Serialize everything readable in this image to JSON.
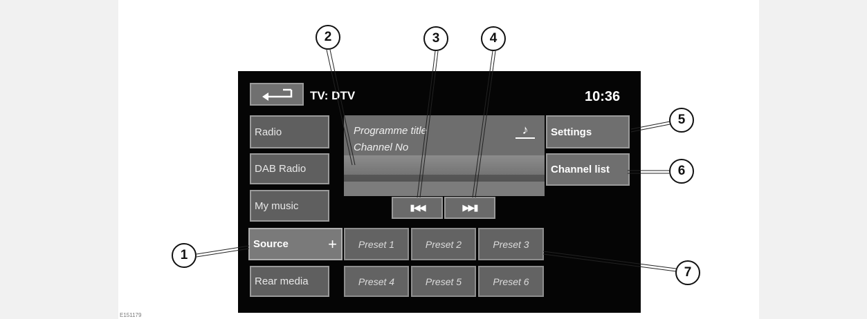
{
  "figure_code": "E151179",
  "screen": {
    "back_icon": "return-arrow-icon",
    "source_title": "TV: DTV",
    "clock": "10:36",
    "left_menu": [
      {
        "label": "Radio"
      },
      {
        "label": "DAB Radio"
      },
      {
        "label": "My music"
      }
    ],
    "source_button": {
      "label": "Source",
      "plus": "+"
    },
    "rear_media_label": "Rear media",
    "video": {
      "programme_title": "Programme title",
      "channel_no": "Channel No",
      "music_icon": "music-note-icon"
    },
    "skip_back_icon": "skip-previous-icon",
    "skip_forward_icon": "skip-next-icon",
    "settings_label": "Settings",
    "channel_list_label": "Channel list",
    "presets": [
      "Preset 1",
      "Preset 2",
      "Preset 3",
      "Preset 4",
      "Preset 5",
      "Preset 6"
    ]
  },
  "callouts": [
    "1",
    "2",
    "3",
    "4",
    "5",
    "6",
    "7"
  ]
}
